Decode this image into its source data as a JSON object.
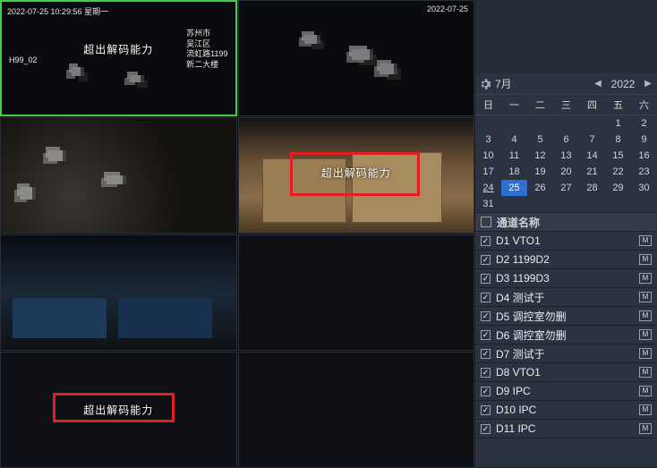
{
  "tiles": [
    {
      "timestamp": "2022-07-25 10:29:56 星期一",
      "ch_label": "H99_02",
      "error": "超出解码能力",
      "location": "苏州市\n吴江区\n流虹路1199\n新二大楼"
    },
    {
      "timestamp_right": "2022-07-25",
      "error": ""
    },
    {
      "timestamp": "",
      "error": ""
    },
    {
      "timestamp": "",
      "error": "超出解码能力",
      "redbox": true
    },
    {
      "timestamp": "",
      "error": ""
    },
    {
      "empty": true
    },
    {
      "empty": true,
      "error": "超出解码能力",
      "redbox": true
    },
    {
      "empty": true
    }
  ],
  "calendar": {
    "month_label": "7月",
    "year": "2022",
    "dow": [
      "日",
      "一",
      "二",
      "三",
      "四",
      "五",
      "六"
    ],
    "leading_blanks": 5,
    "days_in_month": 31,
    "today": 25,
    "marked": [
      24
    ]
  },
  "channels": {
    "header": "通道名称",
    "badge_m": "M",
    "items": [
      {
        "name": "D1 VTO1",
        "checked": true,
        "m": true
      },
      {
        "name": "D2 1199D2",
        "checked": true,
        "m": true
      },
      {
        "name": "D3 1199D3",
        "checked": true,
        "m": true
      },
      {
        "name": "D4 测试于",
        "checked": true,
        "m": true
      },
      {
        "name": "D5 调控室勿删",
        "checked": true,
        "m": true
      },
      {
        "name": "D6 调控室勿删",
        "checked": true,
        "m": true
      },
      {
        "name": "D7 测试于",
        "checked": true,
        "m": true
      },
      {
        "name": "D8 VTO1",
        "checked": true,
        "m": true
      },
      {
        "name": "D9 IPC",
        "checked": true,
        "m": true
      },
      {
        "name": "D10 IPC",
        "checked": true,
        "m": true
      },
      {
        "name": "D11 IPC",
        "checked": true,
        "m": true
      }
    ]
  },
  "glyphs": {
    "chevL": "◀",
    "chevR": "▶",
    "check": "✓"
  }
}
